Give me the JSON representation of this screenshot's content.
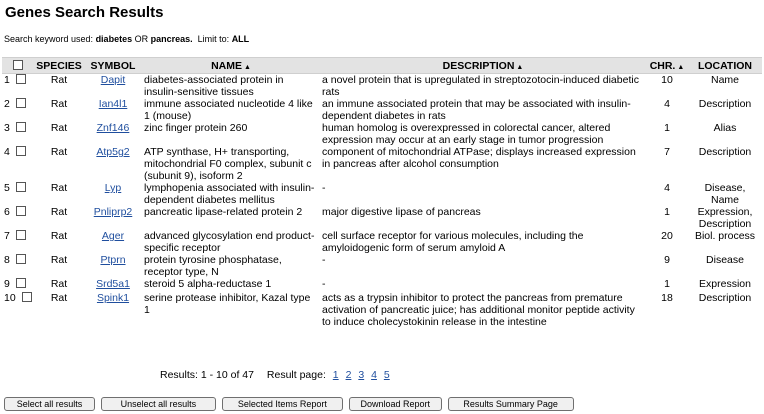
{
  "page": {
    "title": "Genes Search Results",
    "search_prefix": "Search keyword used:",
    "keyword1": "diabetes",
    "or_word": "OR",
    "keyword2": "pancreas.",
    "limit_label": "Limit to:",
    "limit_value": "ALL"
  },
  "table": {
    "headers": {
      "species": "SPECIES",
      "symbol": "SYMBOL",
      "name": "NAME",
      "description": "DESCRIPTION",
      "chr": "CHR.",
      "location": "LOCATION"
    },
    "sort_arrow": "▲",
    "rows": [
      {
        "num": "1",
        "species": "Rat",
        "symbol": "Dapit",
        "name": "diabetes-associated protein in insulin-sensitive tissues",
        "description": "a novel protein that is upregulated in streptozotocin-induced diabetic rats",
        "chr": "10",
        "location": "Name"
      },
      {
        "num": "2",
        "species": "Rat",
        "symbol": "Ian4l1",
        "name": "immune associated nucleotide 4 like 1 (mouse)",
        "description": "an immune associated protein that may be associated with insulin-dependent diabetes in rats",
        "chr": "4",
        "location": "Description"
      },
      {
        "num": "3",
        "species": "Rat",
        "symbol": "Znf146",
        "name": "zinc finger protein 260",
        "description": "human homolog is overexpressed in colorectal cancer, altered expression may occur at an early stage in tumor progression",
        "chr": "1",
        "location": "Alias"
      },
      {
        "num": "4",
        "species": "Rat",
        "symbol": "Atp5g2",
        "name": "ATP synthase, H+ transporting, mitochondrial F0 complex, subunit c (subunit 9), isoform 2",
        "description": "component of mitochondrial ATPase; displays increased expression in pancreas after alcohol consumption",
        "chr": "7",
        "location": "Description"
      },
      {
        "num": "5",
        "species": "Rat",
        "symbol": "Lyp",
        "name": "lymphopenia associated with insulin-dependent diabetes mellitus",
        "description": "-",
        "chr": "4",
        "location": "Disease, Name"
      },
      {
        "num": "6",
        "species": "Rat",
        "symbol": "Pnliprp2",
        "name": "pancreatic lipase-related protein 2",
        "description": "major digestive lipase of pancreas",
        "chr": "1",
        "location": "Expression, Description"
      },
      {
        "num": "7",
        "species": "Rat",
        "symbol": "Ager",
        "name": "advanced glycosylation end product-specific receptor",
        "description": "cell surface receptor for various molecules, including the amyloidogenic form of serum amyloid A",
        "chr": "20",
        "location": "Biol. process"
      },
      {
        "num": "8",
        "species": "Rat",
        "symbol": "Ptprn",
        "name": "protein tyrosine phosphatase, receptor type, N",
        "description": "-",
        "chr": "9",
        "location": "Disease"
      },
      {
        "num": "9",
        "species": "Rat",
        "symbol": "Srd5a1",
        "name": "steroid 5 alpha-reductase 1",
        "description": "-",
        "chr": "1",
        "location": "Expression"
      },
      {
        "num": "10",
        "species": "Rat",
        "symbol": "Spink1",
        "name": "serine protease inhibitor, Kazal type 1",
        "description": "acts as a trypsin inhibitor to protect the pancreas from premature activation of pancreatic juice; has additional monitor peptide activity to induce cholecystokinin release in the intestine",
        "chr": "18",
        "location": "Description"
      }
    ]
  },
  "pager": {
    "results_label": "Results:",
    "range": "1 - 10 of 47",
    "page_label": "Result page:",
    "pages": [
      "1",
      "2",
      "3",
      "4",
      "5"
    ]
  },
  "buttons": {
    "select_all": "Select all results",
    "unselect_all": "Unselect all results",
    "selected_report": "Selected Items Report",
    "download": "Download Report",
    "summary": "Results Summary Page"
  }
}
